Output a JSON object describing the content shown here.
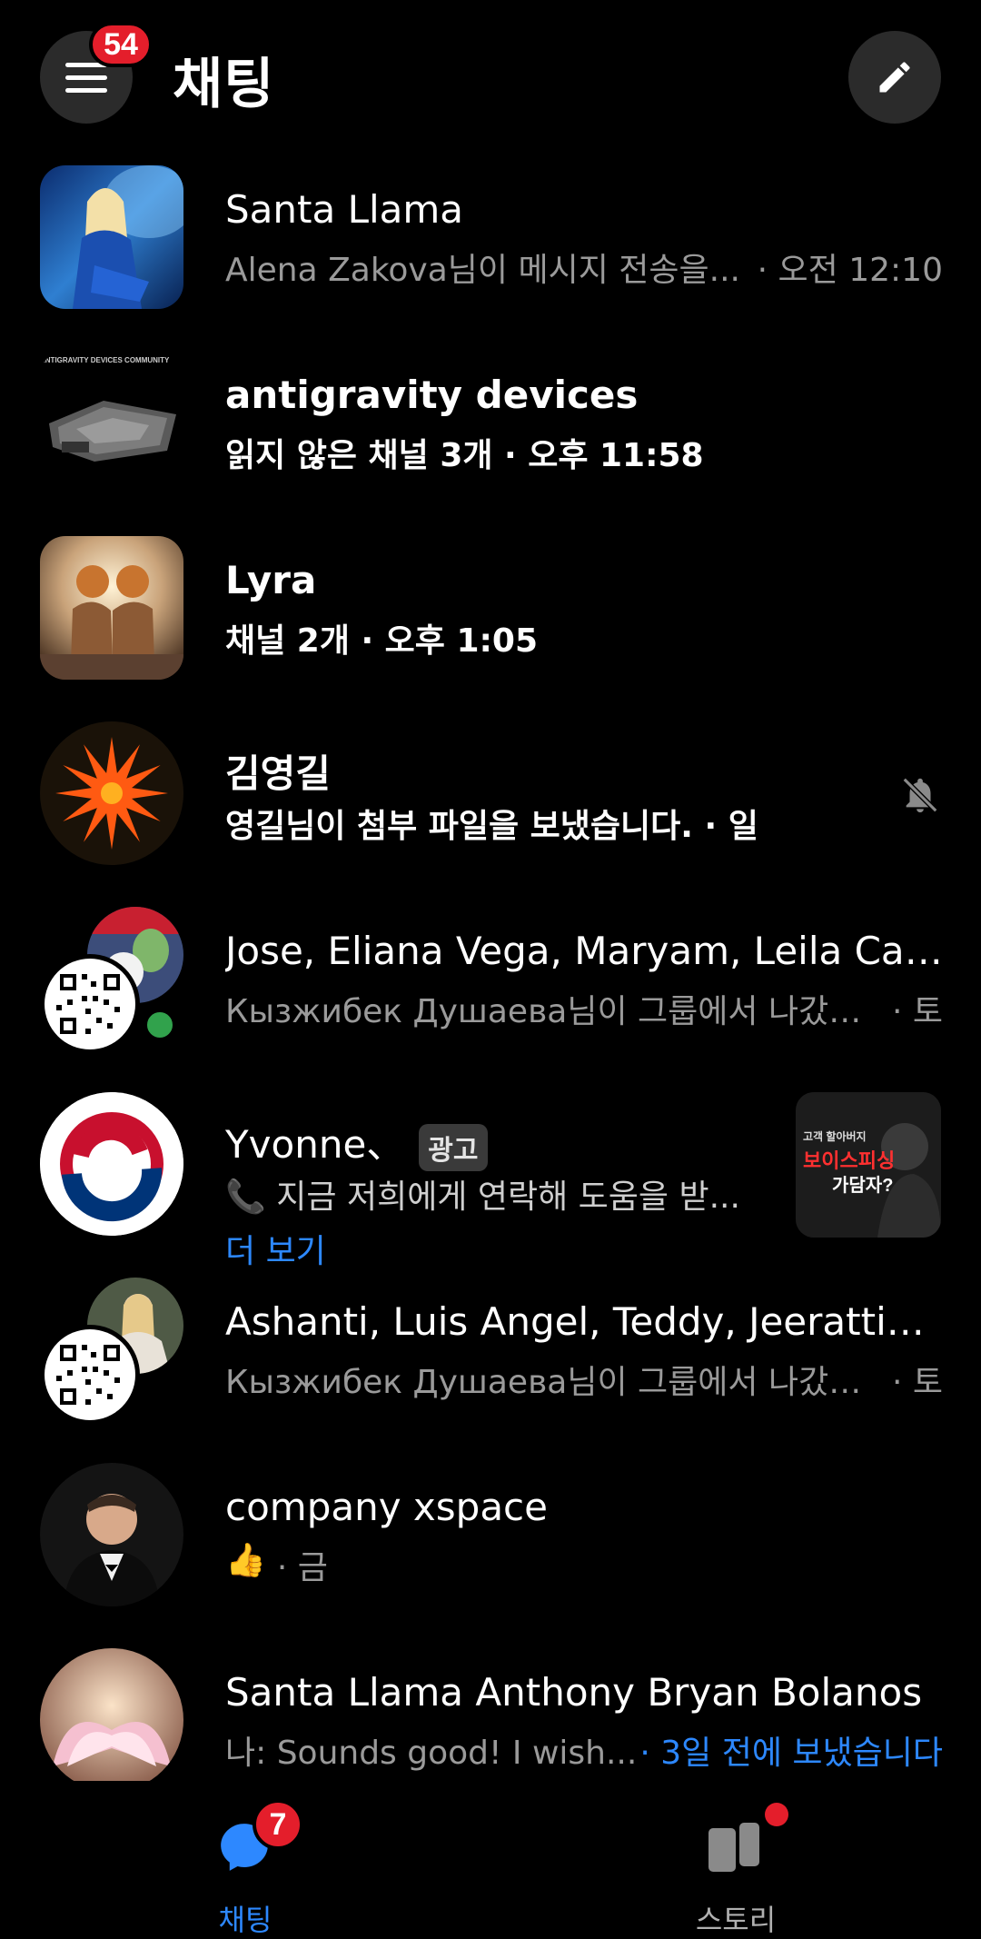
{
  "header": {
    "title": "채팅",
    "menu_badge": "54"
  },
  "chats": [
    {
      "title": "Santa Llama",
      "preview": "Alena Zakova님이 메시지 전송을...",
      "time": "· 오전 12:10"
    },
    {
      "title": "antigravity devices",
      "preview": "읽지 않은 채널 3개 · 오후 11:58",
      "time": "",
      "avatar_text": "ANTIGRAVITY DEVICES COMMUNITY"
    },
    {
      "title": "Lyra",
      "preview": "채널 2개 · 오후 1:05",
      "time": ""
    },
    {
      "title": "김영길",
      "preview": "영길님이 첨부 파일을 보냈습니다. · 일",
      "time": ""
    },
    {
      "title": "Jose, Eliana Vega, Maryam, Leila Calix...",
      "preview": "Кызжибек Душаева님이 그룹에서 나갔습...",
      "time": "· 토"
    },
    {
      "title": "Yvonne、",
      "ad_label": "광고",
      "preview": "📞 지금 저희에게 연락해 도움을 받...",
      "more": "더 보기",
      "ad_thumb_text": [
        "고객 할아버지",
        "보이스피싱",
        "가담자?"
      ]
    },
    {
      "title": "Ashanti, Luis Angel, Teddy, Jeerattikul,...",
      "preview": "Кызжибек Душаева님이 그룹에서 나갔습...",
      "time": "· 토"
    },
    {
      "title": "company xspace",
      "preview": "👍",
      "time": "· 금"
    },
    {
      "title": "Santa Llama Anthony Bryan Bolanos",
      "preview": "나: Sounds good! I wish...",
      "time": "· 3일 전에 보냈습니다"
    }
  ],
  "bottom_nav": {
    "chats": {
      "label": "채팅",
      "badge": "7"
    },
    "stories": {
      "label": "스토리"
    }
  },
  "colors": {
    "accent": "#2d88ff",
    "badge": "#e41e2b",
    "online": "#31a24c"
  }
}
